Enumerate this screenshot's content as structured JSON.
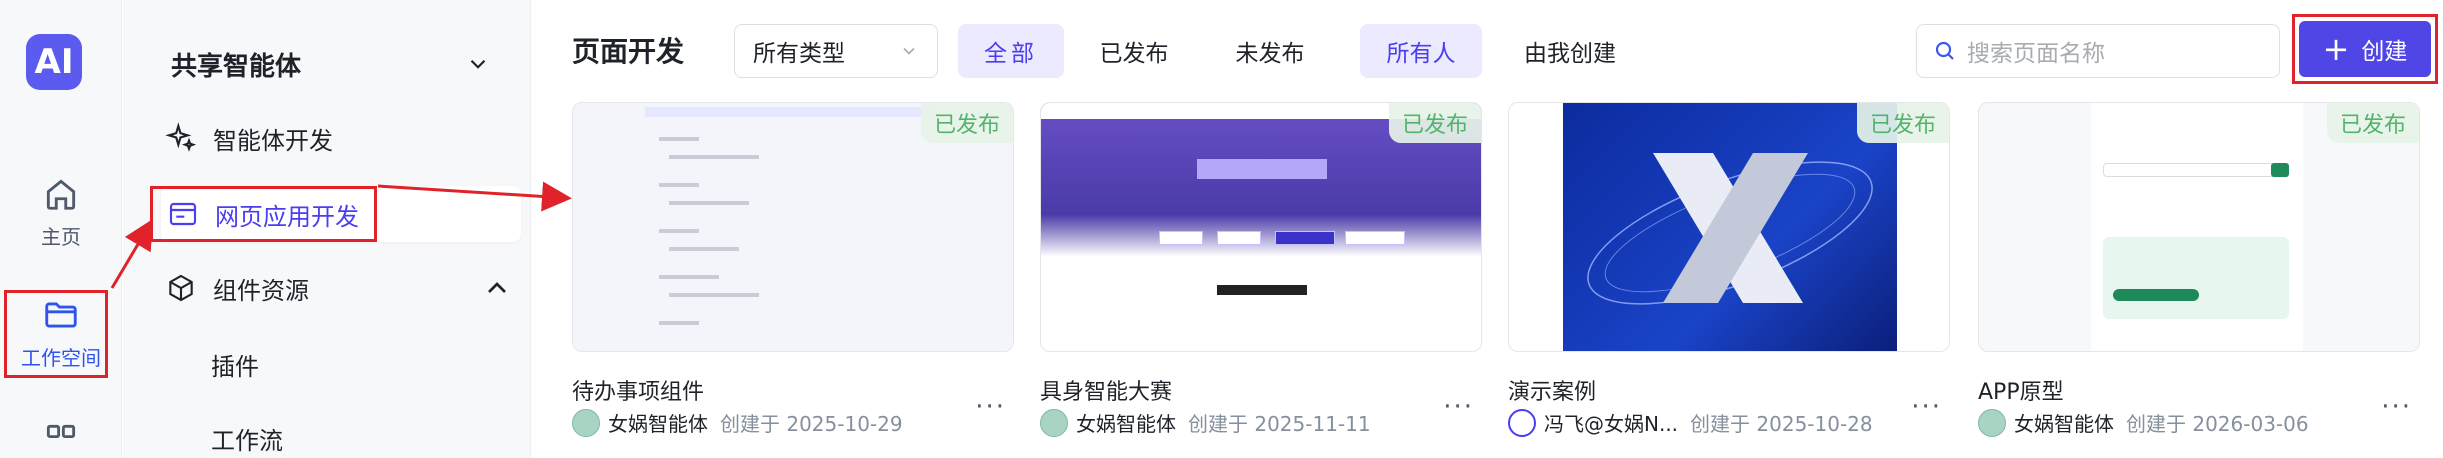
{
  "rail": {
    "logo_text": "AI",
    "home_label": "主页",
    "workspace_label": "工作空间"
  },
  "sidebar": {
    "header": "共享智能体",
    "items": [
      {
        "label": "智能体开发"
      },
      {
        "label": "网页应用开发"
      },
      {
        "label": "组件资源"
      },
      {
        "label": "插件"
      },
      {
        "label": "工作流"
      }
    ]
  },
  "main": {
    "title": "页面开发",
    "type_select": "所有类型",
    "filters": [
      "全部",
      "已发布",
      "未发布",
      "所有人",
      "由我创建"
    ],
    "search_placeholder": "搜索页面名称",
    "create_label": "创建"
  },
  "cards": [
    {
      "name": "待办事项组件",
      "author": "女娲智能体",
      "date": "创建于 2025-10-29",
      "badge": "已发布"
    },
    {
      "name": "具身智能大赛",
      "author": "女娲智能体",
      "date": "创建于 2025-11-11",
      "badge": "已发布"
    },
    {
      "name": "演示案例",
      "author": "冯飞@女娲N...",
      "date": "创建于 2025-10-28",
      "badge": "已发布"
    },
    {
      "name": "APP原型",
      "author": "女娲智能体",
      "date": "创建于 2026-03-06",
      "badge": "已发布"
    }
  ],
  "colors": {
    "accent": "#4f46e5",
    "accent_light": "#ebeafe",
    "annotation_red": "#e0222b",
    "published_green": "#52b36a"
  }
}
